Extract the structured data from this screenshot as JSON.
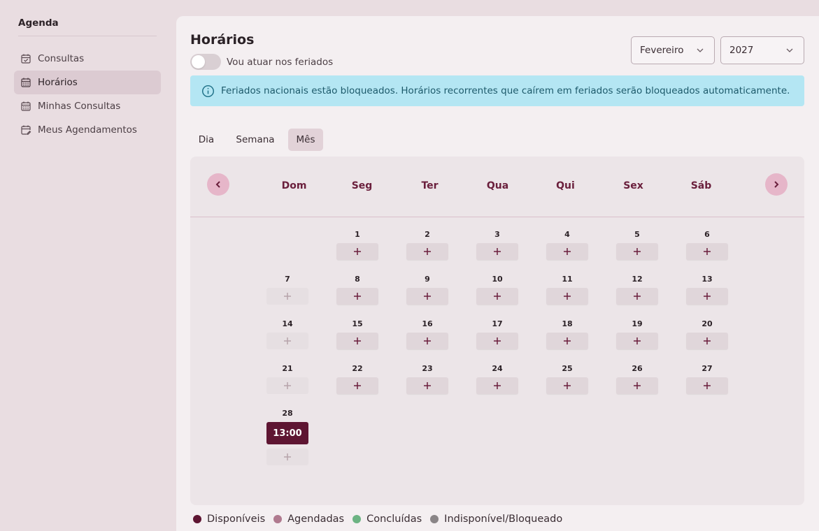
{
  "sidebar": {
    "title": "Agenda",
    "items": [
      {
        "label": "Consultas",
        "icon": "calendar-check-icon",
        "active": false
      },
      {
        "label": "Horários",
        "icon": "calendar-grid-icon",
        "active": true
      },
      {
        "label": "Minhas Consultas",
        "icon": "calendar-grid-icon",
        "active": false
      },
      {
        "label": "Meus Agendamentos",
        "icon": "calendar-edit-icon",
        "active": false
      }
    ]
  },
  "header": {
    "title": "Horários",
    "toggle_label": "Vou atuar nos feriados",
    "toggle_on": false,
    "month_select": "Fevereiro",
    "year_select": "2027"
  },
  "alert": {
    "text": "Feriados nacionais estão bloqueados. Horários recorrentes que caírem em feriados serão bloqueados automaticamente."
  },
  "view_tabs": [
    {
      "label": "Dia",
      "active": false
    },
    {
      "label": "Semana",
      "active": false
    },
    {
      "label": "Mês",
      "active": true
    }
  ],
  "calendar": {
    "weekdays": [
      "Dom",
      "Seg",
      "Ter",
      "Qua",
      "Qui",
      "Sex",
      "Sáb"
    ],
    "first_weekday_index": 1,
    "days_in_month": 28,
    "disabled_days": [
      7,
      14,
      21,
      28
    ],
    "slots": [
      {
        "day": 28,
        "time": "13:00"
      }
    ],
    "add_symbol": "+"
  },
  "legend": [
    {
      "label": "Disponíveis",
      "color": "#5e1532"
    },
    {
      "label": "Agendadas",
      "color": "#b07a8f"
    },
    {
      "label": "Concluídas",
      "color": "#6cb383"
    },
    {
      "label": "Indisponível/Bloqueado",
      "color": "#8a8587"
    }
  ],
  "colors": {
    "accent": "#6a1f3c",
    "alert_bg": "#b4e6f3",
    "alert_text": "#1d5a6b"
  }
}
